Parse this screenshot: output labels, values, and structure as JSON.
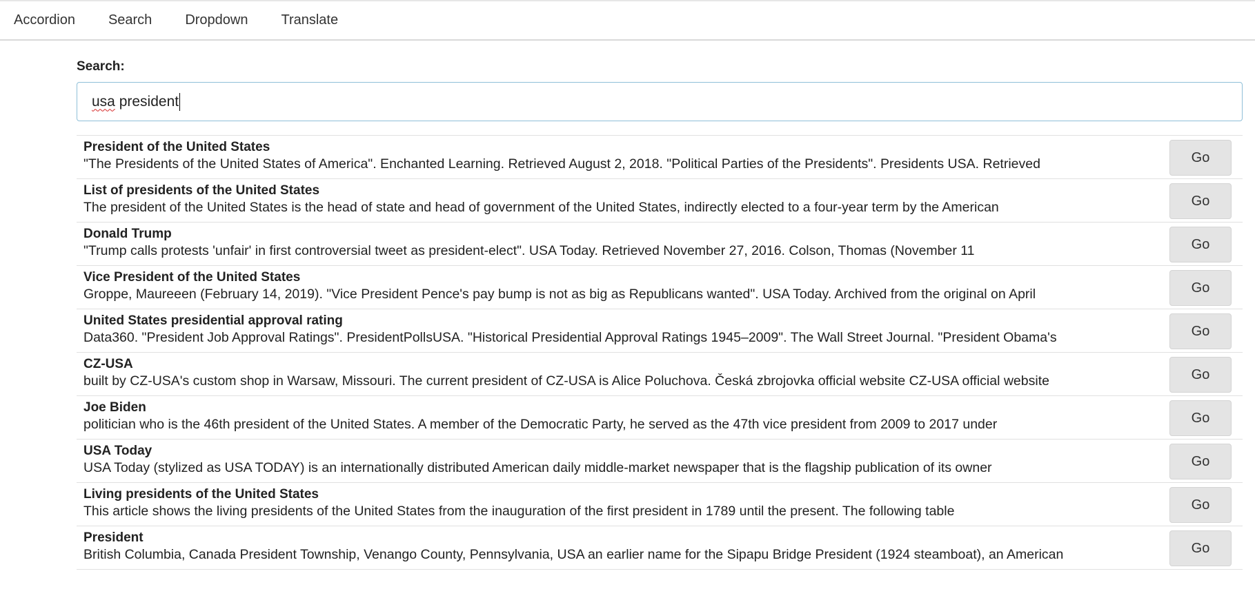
{
  "nav": {
    "items": [
      "Accordion",
      "Search",
      "Dropdown",
      "Translate"
    ]
  },
  "search": {
    "label": "Search:",
    "value_part1": "usa",
    "value_part2": " president"
  },
  "results": [
    {
      "title": "President of the United States",
      "snippet": "\"The Presidents of the United States of America\". Enchanted Learning. Retrieved August 2, 2018. \"Political Parties of the Presidents\". Presidents USA. Retrieved",
      "button": "Go"
    },
    {
      "title": "List of presidents of the United States",
      "snippet": "The president of the United States is the head of state and head of government of the United States, indirectly elected to a four-year term by the American",
      "button": "Go"
    },
    {
      "title": "Donald Trump",
      "snippet": "\"Trump calls protests 'unfair' in first controversial tweet as president-elect\". USA Today. Retrieved November 27, 2016. Colson, Thomas (November 11",
      "button": "Go"
    },
    {
      "title": "Vice President of the United States",
      "snippet": "Groppe, Maureeen (February 14, 2019). \"Vice President Pence's pay bump is not as big as Republicans wanted\". USA Today. Archived from the original on April",
      "button": "Go"
    },
    {
      "title": "United States presidential approval rating",
      "snippet": "Data360. \"President Job Approval Ratings\". PresidentPollsUSA. \"Historical Presidential Approval Ratings 1945–2009\". The Wall Street Journal. \"President Obama's",
      "button": "Go"
    },
    {
      "title": "CZ-USA",
      "snippet": "built by CZ-USA's custom shop in Warsaw, Missouri. The current president of CZ-USA is Alice Poluchova. Česká zbrojovka official website CZ-USA official website",
      "button": "Go"
    },
    {
      "title": "Joe Biden",
      "snippet": "politician who is the 46th president of the United States. A member of the Democratic Party, he served as the 47th vice president from 2009 to 2017 under",
      "button": "Go"
    },
    {
      "title": "USA Today",
      "snippet": "USA Today (stylized as USA TODAY) is an internationally distributed American daily middle-market newspaper that is the flagship publication of its owner",
      "button": "Go"
    },
    {
      "title": "Living presidents of the United States",
      "snippet": "This article shows the living presidents of the United States from the inauguration of the first president in 1789 until the present. The following table",
      "button": "Go"
    },
    {
      "title": "President",
      "snippet": "British Columbia, Canada President Township, Venango County, Pennsylvania, USA an earlier name for the Sipapu Bridge President (1924 steamboat), an American",
      "button": "Go"
    }
  ]
}
